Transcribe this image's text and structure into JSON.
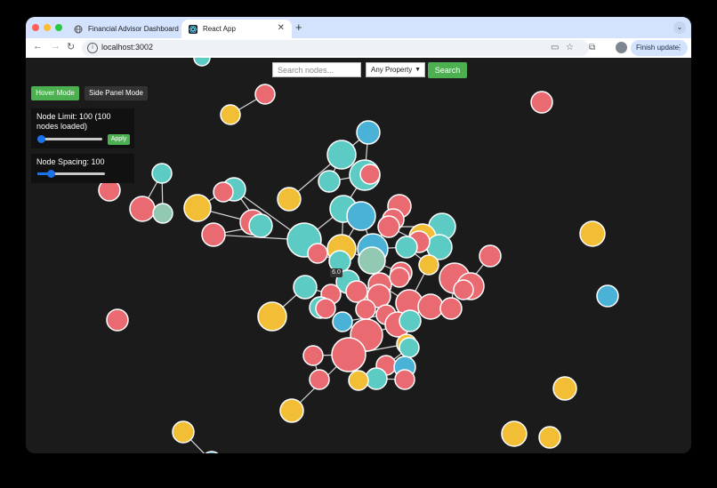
{
  "browser": {
    "tabs": [
      {
        "title": "Financial Advisor Dashboard",
        "active": false
      },
      {
        "title": "React App",
        "active": true
      }
    ],
    "url": "localhost:3002",
    "finish_update": "Finish update",
    "new_tab": "+",
    "tab_menu": "⌄"
  },
  "search": {
    "placeholder": "Search nodes...",
    "property_selected": "Any Property",
    "button": "Search"
  },
  "modes": {
    "hover": "Hover Mode",
    "side_panel": "Side Panel Mode"
  },
  "controls": {
    "node_limit_label": "Node Limit: 100 (100 nodes loaded)",
    "node_limit_value": 100,
    "node_limit_fraction": 0.05,
    "apply_label": "Apply",
    "spacing_label": "Node Spacing: 100",
    "spacing_fraction": 0.2
  },
  "tooltip": "6.0",
  "colors": {
    "red": "#ea6a72",
    "teal": "#5ccbc3",
    "yellow": "#f2be36",
    "blue": "#4ab2d6",
    "sage": "#92c9b3",
    "green": "#4caf50",
    "accent": "#1a73e8"
  },
  "icons": {
    "back": "arrow-left-icon",
    "forward": "arrow-right-icon",
    "reload": "reload-icon",
    "info": "info-icon",
    "install": "install-app-icon",
    "star": "star-icon",
    "extensions": "puzzle-icon",
    "menu": "kebab-menu-icon"
  }
}
